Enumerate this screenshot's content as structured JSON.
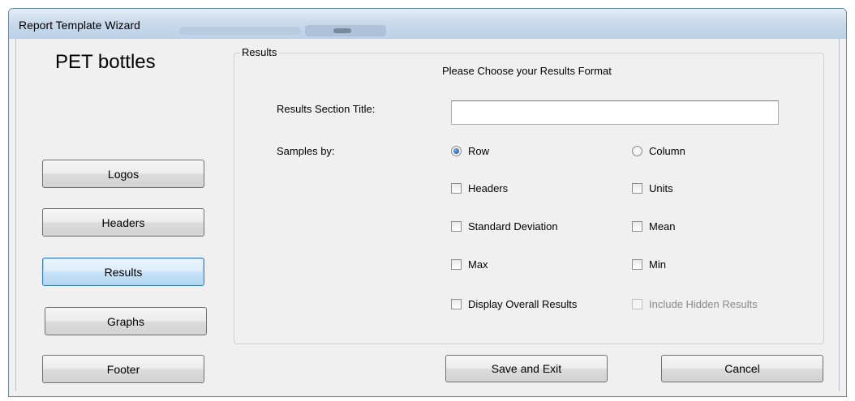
{
  "window": {
    "title": "Report Template Wizard"
  },
  "product_name": "PET bottles",
  "nav": [
    {
      "label": "Logos"
    },
    {
      "label": "Headers"
    },
    {
      "label": "Results",
      "active": true
    },
    {
      "label": "Graphs"
    },
    {
      "label": "Footer"
    }
  ],
  "results": {
    "group_label": "Results",
    "prompt": "Please Choose your Results Format",
    "section_title_label": "Results Section Title:",
    "section_title_value": "",
    "samples_by_label": "Samples by:",
    "samples_by": {
      "row_label": "Row",
      "column_label": "Column",
      "selected": "Row"
    },
    "options": [
      {
        "label": "Headers",
        "checked": false,
        "enabled": true
      },
      {
        "label": "Units",
        "checked": false,
        "enabled": true
      },
      {
        "label": "Standard Deviation",
        "checked": false,
        "enabled": true
      },
      {
        "label": "Mean",
        "checked": false,
        "enabled": true
      },
      {
        "label": "Max",
        "checked": false,
        "enabled": true
      },
      {
        "label": "Min",
        "checked": false,
        "enabled": true
      },
      {
        "label": "Display Overall Results",
        "checked": false,
        "enabled": true
      },
      {
        "label": "Include Hidden Results",
        "checked": false,
        "enabled": false
      }
    ]
  },
  "footer_buttons": {
    "save": "Save and Exit",
    "cancel": "Cancel"
  },
  "colors": {
    "active_nav": "#c6e2f7",
    "title_bar": "#c9daec"
  }
}
